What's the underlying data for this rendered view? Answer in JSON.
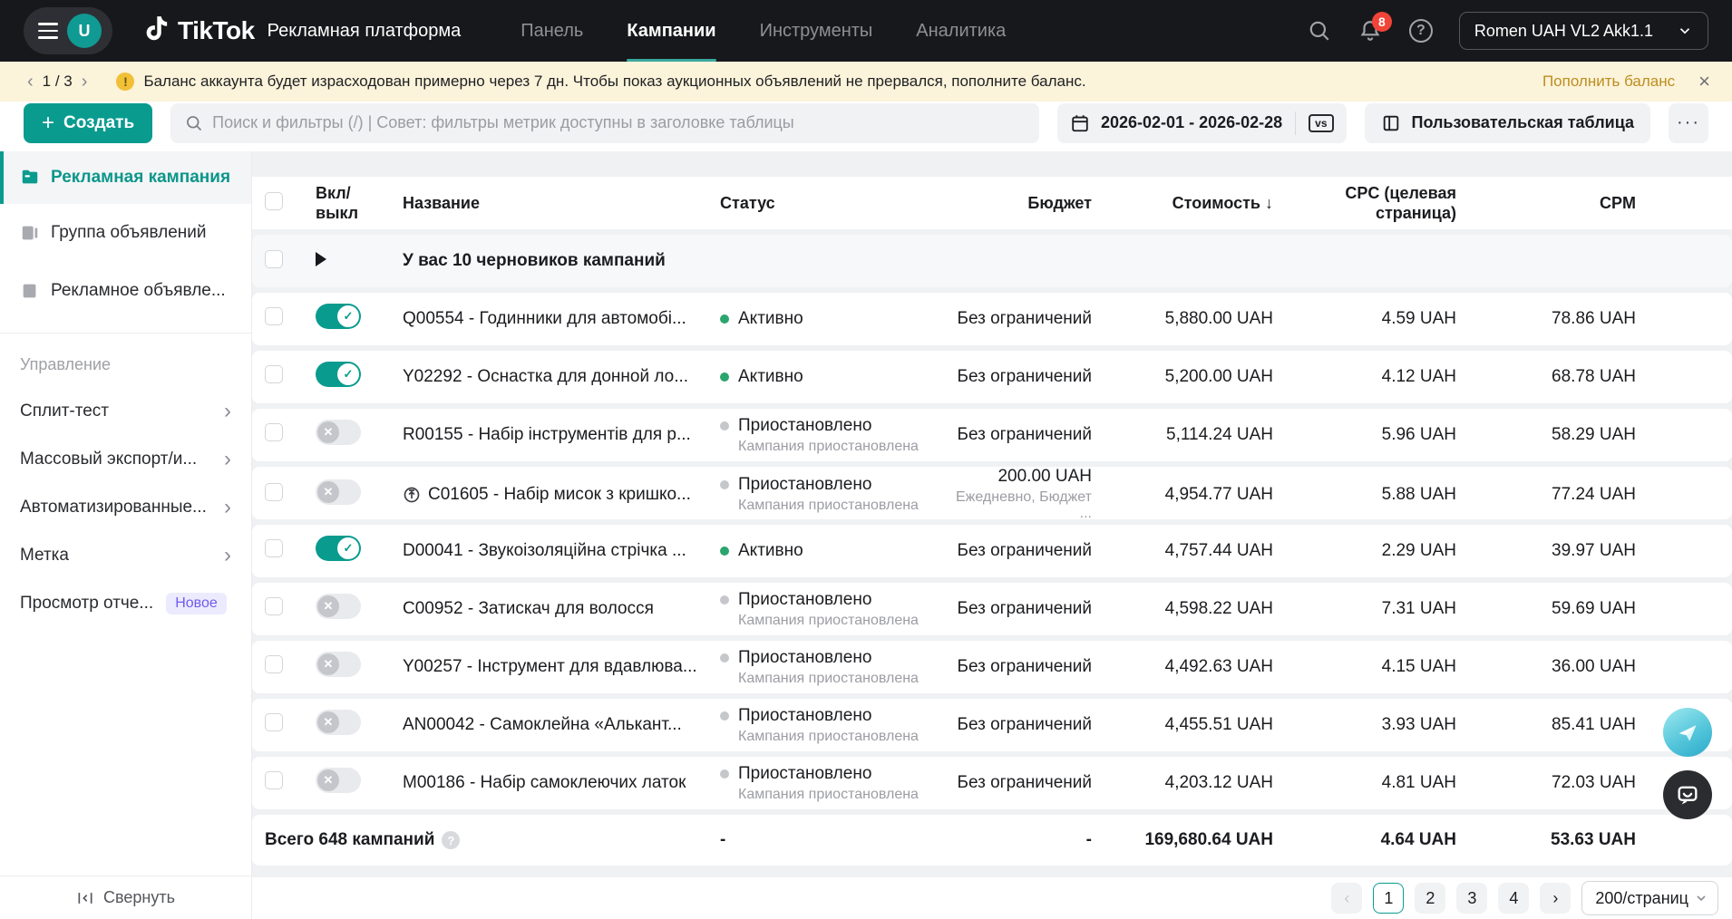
{
  "header": {
    "brand": "TikTok",
    "subtitle": "Рекламная платформа",
    "avatar": "U",
    "nav": [
      {
        "label": "Панель"
      },
      {
        "label": "Кампании"
      },
      {
        "label": "Инструменты"
      },
      {
        "label": "Аналитика"
      }
    ],
    "notification_count": "8",
    "help": "?",
    "account": "Romen UAH VL2 Akk1.1"
  },
  "banner": {
    "pager": "1 / 3",
    "prev": "‹",
    "next": "›",
    "warn": "!",
    "message": "Баланс аккаунта будет израсходован примерно через 7 дн. Чтобы показ аукционных объявлений не прервался, пополните баланс.",
    "action": "Пополнить баланс",
    "close": "×"
  },
  "toolbar": {
    "create_plus": "+",
    "create": "Создать",
    "search_placeholder": "Поиск и фильтры (/) | Совет: фильтры метрик доступны в заголовке таблицы",
    "date_range": "2026-02-01 - 2026-02-28",
    "vs": "vs",
    "custom_table": "Пользовательская таблица",
    "more": "···"
  },
  "sidebar": {
    "items": [
      {
        "label": "Рекламная кампания",
        "active": true
      },
      {
        "label": "Группа объявлений",
        "active": false
      },
      {
        "label": "Рекламное объявле...",
        "active": false
      }
    ],
    "section": "Управление",
    "management": [
      {
        "label": "Сплит-тест",
        "chevron": "›"
      },
      {
        "label": "Массовый экспорт/и...",
        "chevron": "›"
      },
      {
        "label": "Автоматизированные...",
        "chevron": "›"
      },
      {
        "label": "Метка",
        "chevron": "›"
      },
      {
        "label": "Просмотр отче...",
        "badge": "Новое"
      }
    ],
    "collapse": "Свернуть"
  },
  "table": {
    "columns": [
      "Вкл/выкл",
      "Название",
      "Статус",
      "Бюджет",
      "Стоимость ↓",
      "CPC (целевая страница)",
      "CPM"
    ],
    "drafts_label": "У вас 10 черновиков кампаний",
    "rows": [
      {
        "enabled": true,
        "name": "Q00554 - Годинники для автомобі...",
        "status": "Активно",
        "budget": "Без ограничений",
        "cost": "5,880.00 UAH",
        "cpc": "4.59 UAH",
        "cpm": "78.86 UAH"
      },
      {
        "enabled": true,
        "name": "Y02292 - Оснастка для донной ло...",
        "status": "Активно",
        "budget": "Без ограничений",
        "cost": "5,200.00 UAH",
        "cpc": "4.12 UAH",
        "cpm": "68.78 UAH"
      },
      {
        "enabled": false,
        "name": "R00155 - Набір інструментів для р...",
        "status": "Приостановлено",
        "status_sub": "Кампания приостановлена",
        "budget": "Без ограничений",
        "cost": "5,114.24 UAH",
        "cpc": "5.96 UAH",
        "cpm": "58.29 UAH"
      },
      {
        "enabled": false,
        "name": "C01605 - Набір мисок з кришко...",
        "status": "Приостановлено",
        "status_sub": "Кампания приостановлена",
        "budget": "200.00 UAH",
        "budget_sub": "Ежедневно, Бюджет ...",
        "cost": "4,954.77 UAH",
        "cpc": "5.88 UAH",
        "cpm": "77.24 UAH",
        "type_icon": true
      },
      {
        "enabled": true,
        "name": "D00041 - Звукоізоляційна стрічка ...",
        "status": "Активно",
        "budget": "Без ограничений",
        "cost": "4,757.44 UAH",
        "cpc": "2.29 UAH",
        "cpm": "39.97 UAH"
      },
      {
        "enabled": false,
        "name": "C00952 - Затискач для волосся",
        "status": "Приостановлено",
        "status_sub": "Кампания приостановлена",
        "budget": "Без ограничений",
        "cost": "4,598.22 UAH",
        "cpc": "7.31 UAH",
        "cpm": "59.69 UAH"
      },
      {
        "enabled": false,
        "name": "Y00257 - Інструмент для вдавлюва...",
        "status": "Приостановлено",
        "status_sub": "Кампания приостановлена",
        "budget": "Без ограничений",
        "cost": "4,492.63 UAH",
        "cpc": "4.15 UAH",
        "cpm": "36.00 UAH"
      },
      {
        "enabled": false,
        "name": "AN00042 - Самоклейна «Алькант...",
        "status": "Приостановлено",
        "status_sub": "Кампания приостановлена",
        "budget": "Без ограничений",
        "cost": "4,455.51 UAH",
        "cpc": "3.93 UAH",
        "cpm": "85.41 UAH"
      },
      {
        "enabled": false,
        "name": "M00186 - Набір самоклеючих латок",
        "status": "Приостановлено",
        "status_sub": "Кампания приостановлена",
        "budget": "Без ограничений",
        "cost": "4,203.12 UAH",
        "cpc": "4.81 UAH",
        "cpm": "72.03 UAH"
      }
    ],
    "totals": {
      "label": "Всего 648 кампаний",
      "help": "?",
      "status": "-",
      "budget": "-",
      "cost": "169,680.64 UAH",
      "cpc": "4.64 UAH",
      "cpm": "53.63 UAH"
    }
  },
  "pagination": {
    "prev": "‹",
    "next": "›",
    "pages": [
      "1",
      "2",
      "3",
      "4"
    ],
    "active": "1",
    "page_size": "200/страниц"
  },
  "icons": {
    "tiktok-note": "music-note",
    "search": "magnifier",
    "bell": "notification-bell",
    "calendar": "calendar",
    "columns": "table-columns",
    "paper-plane": "promote",
    "chat-bubble": "support-chat"
  },
  "colors": {
    "accent": "#0a9b8f",
    "header_bg": "#17181b",
    "banner_bg": "#fbf3da",
    "banner_action": "#bd8e1e",
    "badge_red": "#f04438",
    "status_green": "#2aa56c",
    "new_badge_bg": "#ecebfd",
    "new_badge_text": "#6f5bf0"
  }
}
